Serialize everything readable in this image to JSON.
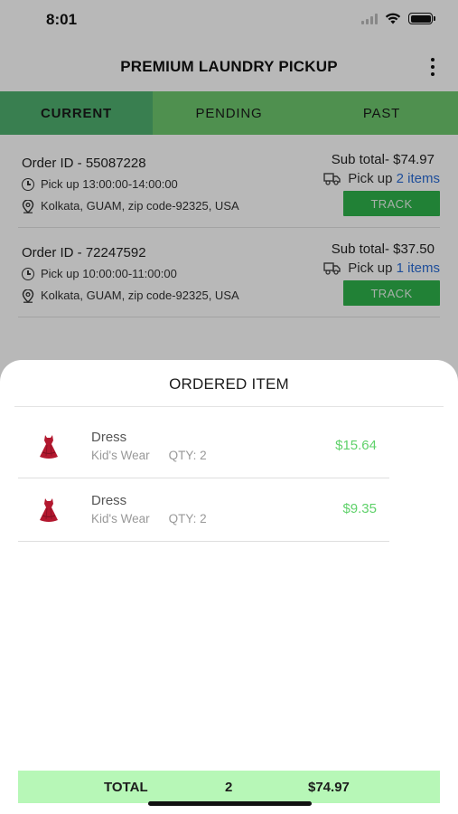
{
  "status_bar": {
    "time": "8:01"
  },
  "header": {
    "title": "PREMIUM LAUNDRY PICKUP",
    "menu_icon": "more-vertical-icon"
  },
  "tabs": [
    {
      "label": "CURRENT",
      "active": true
    },
    {
      "label": "PENDING",
      "active": false
    },
    {
      "label": "PAST",
      "active": false
    }
  ],
  "orders": [
    {
      "order_id": "Order ID - 55087228",
      "pickup_time": "Pick up 13:00:00-14:00:00",
      "address": "Kolkata, GUAM, zip code-92325, USA",
      "subtotal": "Sub total- $74.97",
      "pickup_prefix": "Pick up",
      "pickup_count": "2 items",
      "track_label": "TRACK"
    },
    {
      "order_id": "Order ID - 72247592",
      "pickup_time": "Pick up 10:00:00-11:00:00",
      "address": "Kolkata, GUAM, zip code-92325, USA",
      "subtotal": "Sub total- $37.50",
      "pickup_prefix": "Pick up",
      "pickup_count": "1 items",
      "track_label": "TRACK"
    }
  ],
  "sheet": {
    "title": "ORDERED ITEM",
    "items": [
      {
        "name": "Dress",
        "category": "Kid's Wear",
        "qty": "QTY: 2",
        "price": "$15.64",
        "icon": "dress-icon"
      },
      {
        "name": "Dress",
        "category": "Kid's Wear",
        "qty": "QTY: 2",
        "price": "$9.35",
        "icon": "dress-icon"
      }
    ],
    "total": {
      "label": "TOTAL",
      "qty": "2",
      "amount": "$74.97"
    }
  },
  "colors": {
    "tab_bar": "#6ec86e",
    "tab_active": "#4fb070",
    "track_button": "#2eb34c",
    "price": "#5fd16a",
    "total_bar": "#b7f7b7",
    "link": "#2b6dd6",
    "dress": "#b3182f"
  }
}
